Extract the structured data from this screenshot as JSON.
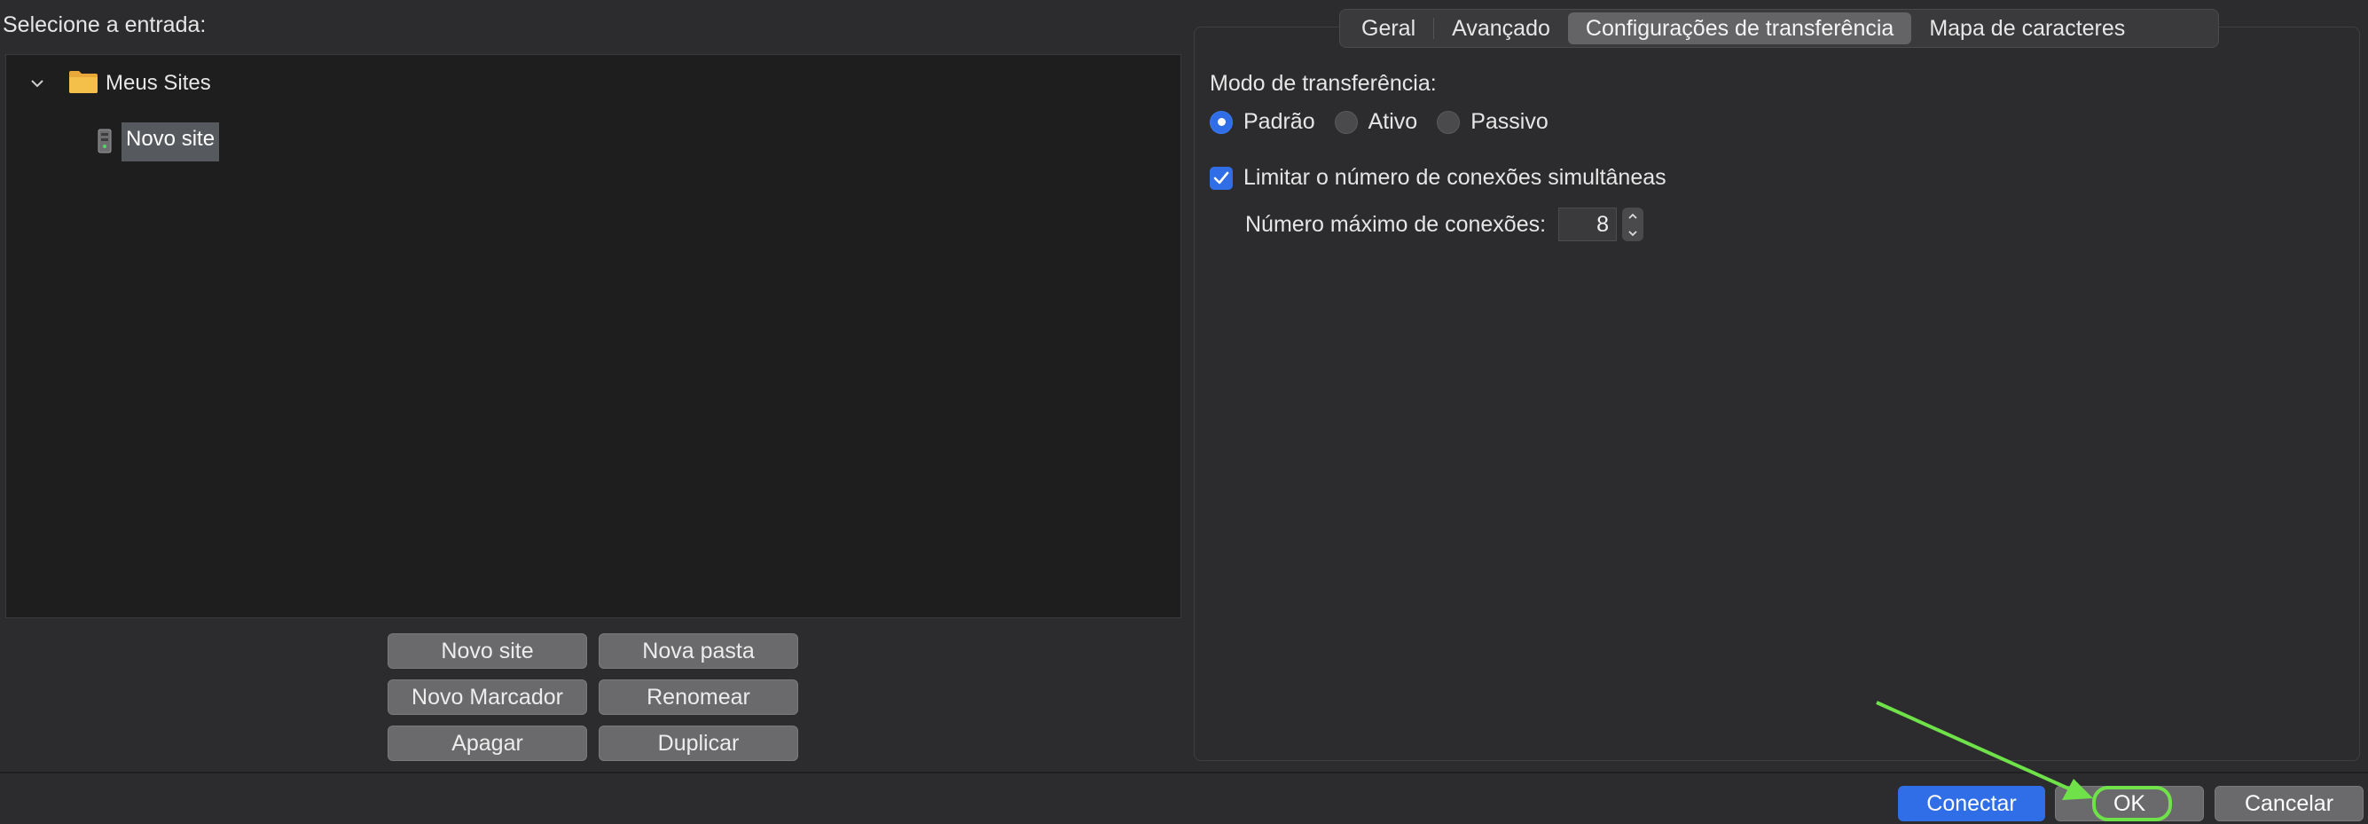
{
  "left": {
    "entry_label": "Selecione a entrada:",
    "tree": {
      "folder_label": "Meus Sites",
      "site_label": "Novo site"
    },
    "buttons": {
      "new_site": "Novo site",
      "new_folder": "Nova pasta",
      "new_bookmark": "Novo Marcador",
      "rename": "Renomear",
      "delete": "Apagar",
      "duplicate": "Duplicar"
    }
  },
  "tabs": [
    {
      "label": "Geral",
      "active": false
    },
    {
      "label": "Avançado",
      "active": false
    },
    {
      "label": "Configurações de transferência",
      "active": true
    },
    {
      "label": "Mapa de caracteres",
      "active": false
    }
  ],
  "transfer": {
    "mode_label": "Modo de transferência:",
    "modes": [
      {
        "label": "Padrão",
        "selected": true
      },
      {
        "label": "Ativo",
        "selected": false
      },
      {
        "label": "Passivo",
        "selected": false
      }
    ],
    "limit_label": "Limitar o número de conexões simultâneas",
    "limit_checked": true,
    "max_label": "Número máximo de conexões:",
    "max_value": "8"
  },
  "footer": {
    "connect": "Conectar",
    "ok": "OK",
    "cancel": "Cancelar"
  },
  "colors": {
    "accent": "#2f6ee6",
    "annotation": "#6fe24a"
  }
}
